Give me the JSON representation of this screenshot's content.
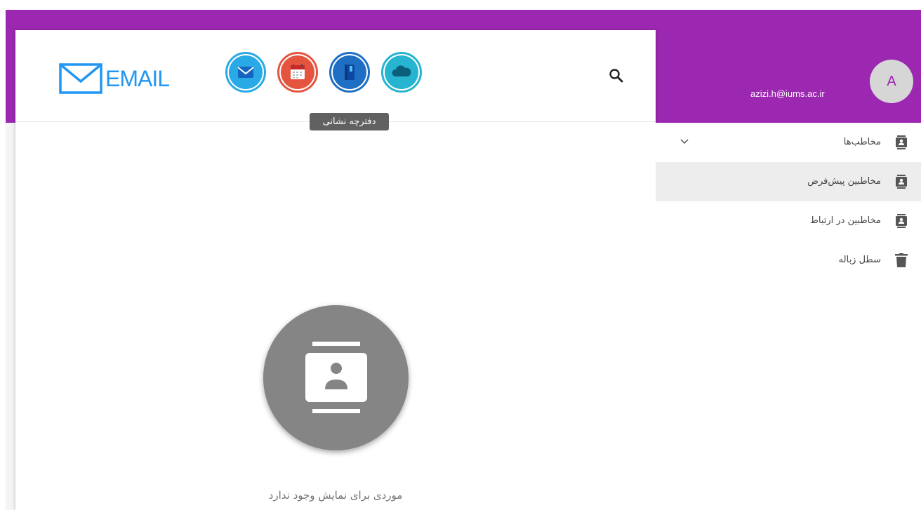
{
  "header": {
    "logo_text": "EMAIL",
    "apps": [
      {
        "name": "mail",
        "icon": "envelope-icon",
        "color": "#29a9e6"
      },
      {
        "name": "calendar",
        "icon": "calendar-icon",
        "color": "#e5543e"
      },
      {
        "name": "address-book",
        "icon": "address-book-icon",
        "color": "#1e6fc4"
      },
      {
        "name": "cloud",
        "icon": "cloud-icon",
        "color": "#26b4d1"
      }
    ],
    "tooltip": "دفترچه نشانی",
    "search_icon": "search-icon"
  },
  "user": {
    "email": "azizi.h@iums.ac.ir",
    "avatar_letter": "A"
  },
  "sidebar": {
    "items": [
      {
        "label": "مخاطب‌ها",
        "icon": "contacts-icon",
        "has_chevron": true
      },
      {
        "label": "مخاطبین پیش‌فرض",
        "icon": "contacts-icon",
        "active": true
      },
      {
        "label": "مخاطبین در ارتباط",
        "icon": "contacts-icon"
      },
      {
        "label": "سطل زباله",
        "icon": "trash-icon"
      }
    ]
  },
  "main": {
    "empty_icon": "contacts-icon",
    "empty_text": "موردی برای نمایش وجود ندارد"
  },
  "colors": {
    "brand": "#9c27b0",
    "logo": "#2196f3"
  }
}
